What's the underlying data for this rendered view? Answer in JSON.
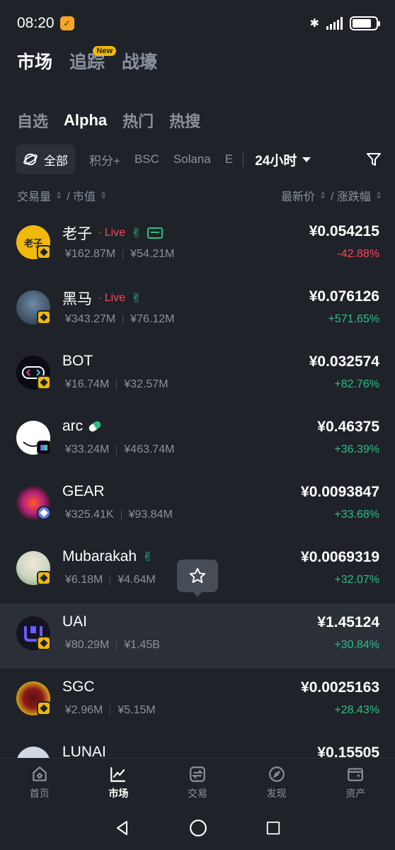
{
  "status": {
    "time": "08:20"
  },
  "top_tabs": [
    {
      "label": "市场",
      "active": true
    },
    {
      "label": "追踪",
      "badge": "New"
    },
    {
      "label": "战壕"
    }
  ],
  "sub_tabs": [
    {
      "label": "自选"
    },
    {
      "label": "Alpha",
      "active": true
    },
    {
      "label": "热门"
    },
    {
      "label": "热搜"
    }
  ],
  "chains": {
    "all": "全部",
    "items": [
      "积分+",
      "BSC",
      "Solana",
      "E"
    ]
  },
  "period": "24小时",
  "sort": {
    "volume": "交易量",
    "mcap": "/ 市值",
    "price": "最新价",
    "change": "/ 涨跌幅"
  },
  "tokens": [
    {
      "name": "老子",
      "live": "· Live",
      "volume": "¥162.87M",
      "mcap": "¥54.21M",
      "price": "¥0.054215",
      "change": "-42.88%",
      "direction": "down",
      "chain": "bsc",
      "avatar_text": "老子",
      "avatar_color": "#f0b90b"
    },
    {
      "name": "黑马",
      "live": "· Live",
      "volume": "¥343.27M",
      "mcap": "¥76.12M",
      "price": "¥0.076126",
      "change": "+571.65%",
      "direction": "up",
      "chain": "bsc",
      "avatar_text": "",
      "avatar_color": "#3b4a5a"
    },
    {
      "name": "BOT",
      "volume": "¥16.74M",
      "mcap": "¥32.57M",
      "price": "¥0.032574",
      "change": "+82.76%",
      "direction": "up",
      "chain": "bsc",
      "avatar_text": "",
      "avatar_color": "#0b0b14"
    },
    {
      "name": "arc",
      "volume": "¥33.24M",
      "mcap": "¥463.74M",
      "price": "¥0.46375",
      "change": "+36.39%",
      "direction": "up",
      "chain": "sol",
      "avatar_text": "",
      "avatar_color": "#ffffff"
    },
    {
      "name": "GEAR",
      "volume": "¥325.41K",
      "mcap": "¥93.84M",
      "price": "¥0.0093847",
      "change": "+33.68%",
      "direction": "up",
      "chain": "eth",
      "avatar_text": "",
      "avatar_color": "#2a1a1a"
    },
    {
      "name": "Mubarakah",
      "volume": "¥6.18M",
      "mcap": "¥4.64M",
      "price": "¥0.0069319",
      "change": "+32.07%",
      "direction": "up",
      "chain": "bsc",
      "avatar_text": "",
      "avatar_color": "#c9d6c0"
    },
    {
      "name": "UAI",
      "volume": "¥80.29M",
      "mcap": "¥1.45B",
      "price": "¥1.45124",
      "change": "+30.84%",
      "direction": "up",
      "chain": "bsc",
      "avatar_text": "",
      "avatar_color": "#14141f",
      "highlight": true
    },
    {
      "name": "SGC",
      "volume": "¥2.96M",
      "mcap": "¥5.15M",
      "price": "¥0.0025163",
      "change": "+28.43%",
      "direction": "up",
      "chain": "bsc",
      "avatar_text": "",
      "avatar_color": "#b8860b"
    },
    {
      "name": "LUNAI",
      "volume": "",
      "mcap": "",
      "price": "¥0.15505",
      "change": "",
      "direction": "up",
      "chain": "bsc",
      "avatar_text": "",
      "avatar_color": "#cfd8e3"
    }
  ],
  "bottom_nav": [
    {
      "label": "首页",
      "icon": "home-icon"
    },
    {
      "label": "市场",
      "icon": "market-chart-icon",
      "active": true
    },
    {
      "label": "交易",
      "icon": "trade-swap-icon"
    },
    {
      "label": "发现",
      "icon": "discover-compass-icon"
    },
    {
      "label": "资产",
      "icon": "wallet-icon"
    }
  ],
  "colors": {
    "background": "#1f2329",
    "up": "#2ebd85",
    "down": "#f6465d",
    "accent": "#f0b90b"
  }
}
